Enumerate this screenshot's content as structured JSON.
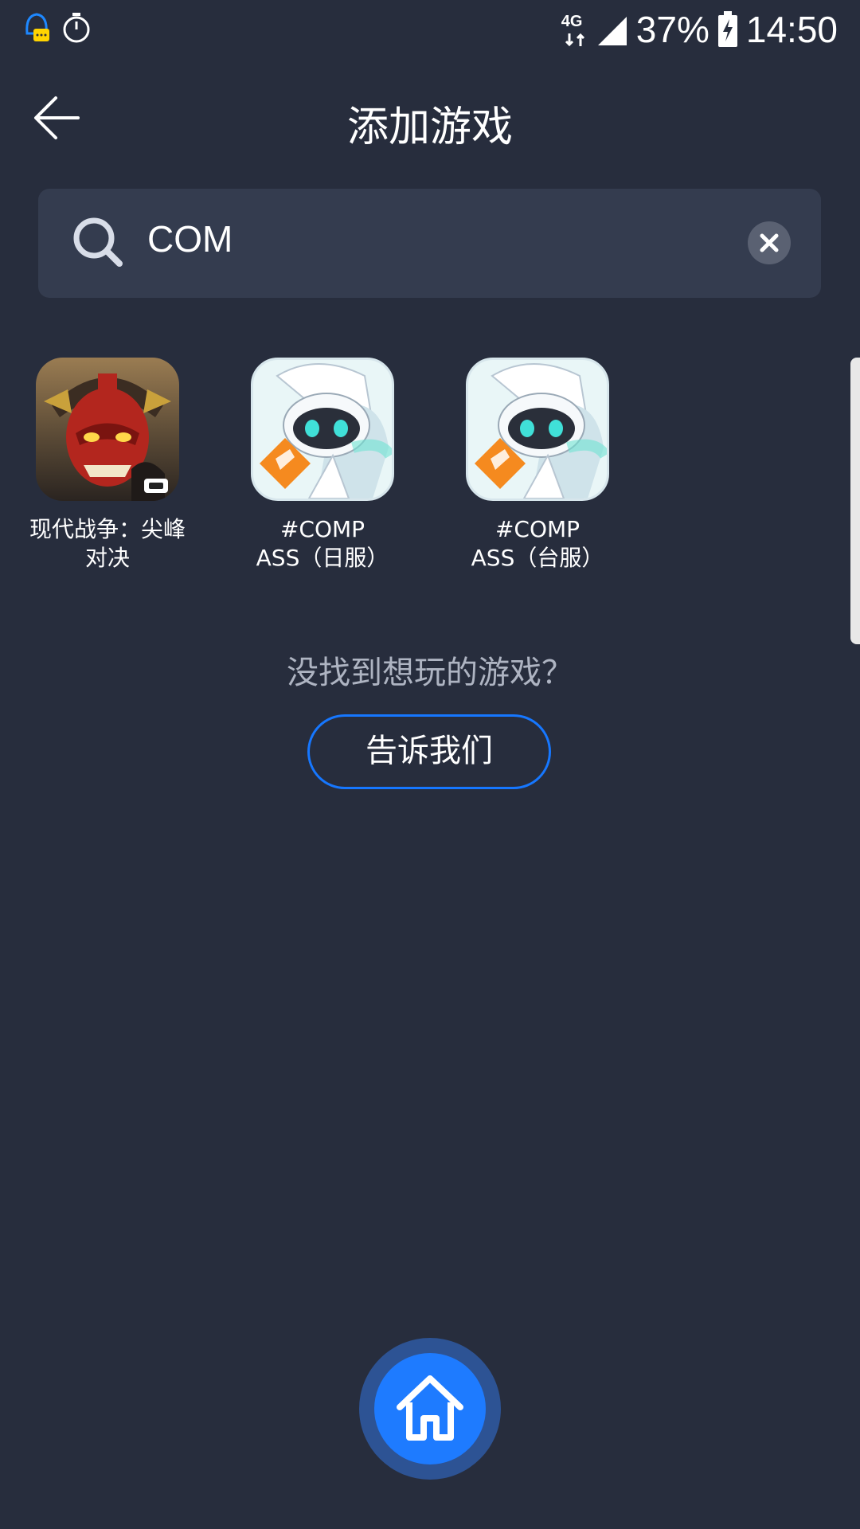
{
  "status_bar": {
    "network": "4G",
    "battery": "37%",
    "time": "14:50",
    "icons": [
      "qq-notification-icon",
      "timer-icon",
      "network-4g-icon",
      "signal-icon",
      "battery-charging-icon"
    ]
  },
  "header": {
    "title": "添加游戏",
    "back_icon": "back-arrow-icon"
  },
  "search": {
    "value": "COM",
    "icon": "search-icon",
    "clear_icon": "clear-icon"
  },
  "results": [
    {
      "name_line1": "现代战争：尖峰",
      "name_line2": "对决",
      "icon": "samurai-game-icon"
    },
    {
      "name_line1": "#COMP",
      "name_line2": "ASS（日服）",
      "icon": "compass-game-icon"
    },
    {
      "name_line1": "#COMP",
      "name_line2": "ASS（台服）",
      "icon": "compass-game-icon"
    }
  ],
  "not_found": {
    "text": "没找到想玩的游戏？",
    "button_label": "告诉我们"
  },
  "bottom_nav": {
    "home_icon": "home-icon"
  },
  "colors": {
    "background": "#272d3d",
    "search_bg": "#343c4f",
    "accent": "#1677ff"
  }
}
